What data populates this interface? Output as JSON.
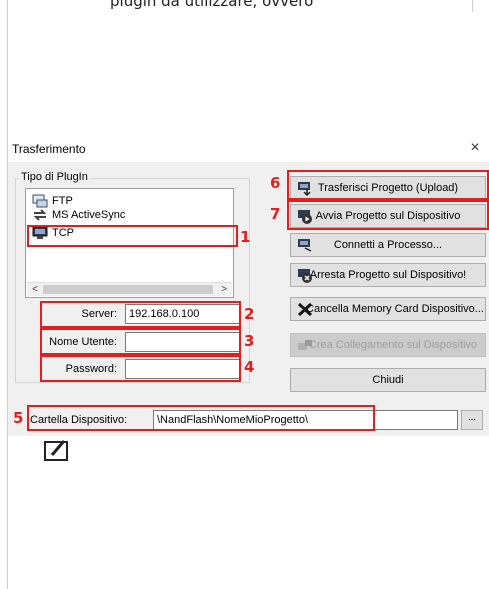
{
  "page": {
    "top_text": "plugin da utilizzare, ovvero"
  },
  "dialog": {
    "title": "Trasferimento",
    "close_glyph": "×",
    "plugin_group": {
      "legend": "Tipo di PlugIn",
      "items": [
        {
          "label": "FTP",
          "icon": "ftp-icon"
        },
        {
          "label": "MS ActiveSync",
          "icon": "activesync-icon"
        },
        {
          "label": "TCP",
          "icon": "tcp-icon"
        }
      ],
      "scroll_left": "<",
      "scroll_right": ">"
    },
    "server": {
      "label": "Server:",
      "value": "192.168.0.100"
    },
    "username": {
      "label": "Nome Utente:",
      "value": ""
    },
    "password": {
      "label": "Password:",
      "value": ""
    },
    "device_folder": {
      "label": "Cartella Dispositivo:",
      "value": "\\NandFlash\\NomeMioProgetto\\",
      "browse": "..."
    },
    "buttons": {
      "upload": "Trasferisci Progetto (Upload)",
      "run": "Avvia Progetto sul Dispositivo",
      "connect": "Connetti a Processo...",
      "stop": "Arresta Progetto sul Dispositivo!",
      "clear_card": "Cancella Memory Card Dispositivo...",
      "create_link": "Crea Collegamento sul Dispositivo",
      "close": "Chiudi"
    },
    "annotations": [
      "1",
      "2",
      "3",
      "4",
      "5",
      "6",
      "7"
    ]
  },
  "colors": {
    "annotation": "#e02020",
    "dialog_bg": "#f0f0f0",
    "button_bg": "#e1e1e1"
  }
}
